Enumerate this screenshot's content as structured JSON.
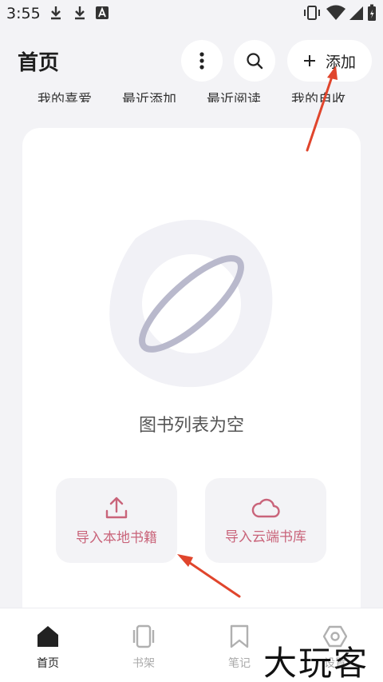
{
  "status_bar": {
    "time": "3:55"
  },
  "header": {
    "title": "首页",
    "add_label": "添加"
  },
  "filter_tabs": [
    "我的喜爱",
    "最近添加",
    "最近阅读",
    "我的自收"
  ],
  "empty_state": {
    "message": "图书列表为空"
  },
  "actions": {
    "import_local": "导入本地书籍",
    "import_cloud": "导入云端书库"
  },
  "bottom_nav": [
    {
      "label": "首页",
      "icon": "home-icon",
      "active": true
    },
    {
      "label": "书架",
      "icon": "bookshelf-icon",
      "active": false
    },
    {
      "label": "笔记",
      "icon": "bookmark-icon",
      "active": false
    },
    {
      "label": "设置",
      "icon": "settings-icon",
      "active": false
    }
  ],
  "watermark": "大玩客",
  "colors": {
    "accent": "#c9647a",
    "background": "#f3f3f6",
    "annotation": "#e0452c"
  }
}
